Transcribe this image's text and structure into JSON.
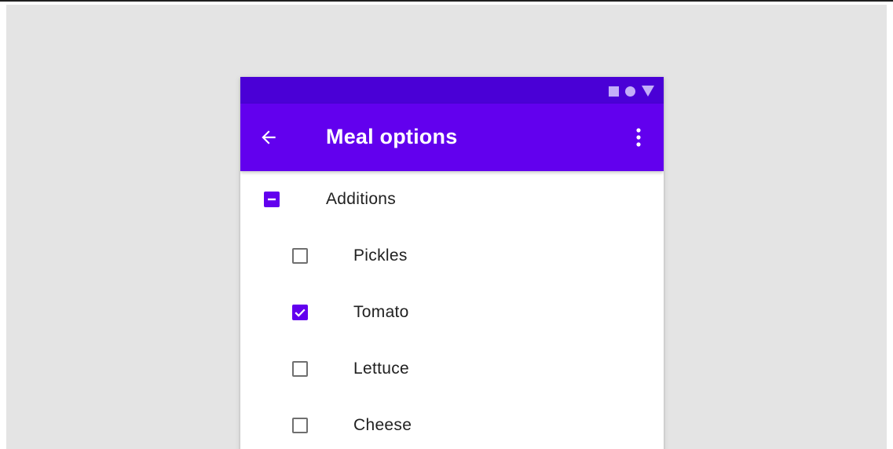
{
  "app_bar": {
    "title": "Meal options"
  },
  "icons": {
    "status": [
      "square-icon",
      "circle-icon",
      "triangle-icon"
    ],
    "back": "arrow-back-icon",
    "more": "more-vert-icon"
  },
  "colors": {
    "status_bar": "#4a00d6",
    "app_bar": "#6200ee",
    "checkbox_accent": "#6200ee",
    "background": "#e4e4e4"
  },
  "list": {
    "parent": {
      "label": "Additions",
      "state": "indeterminate"
    },
    "children": [
      {
        "label": "Pickles",
        "checked": false
      },
      {
        "label": "Tomato",
        "checked": true
      },
      {
        "label": "Lettuce",
        "checked": false
      },
      {
        "label": "Cheese",
        "checked": false
      }
    ]
  }
}
